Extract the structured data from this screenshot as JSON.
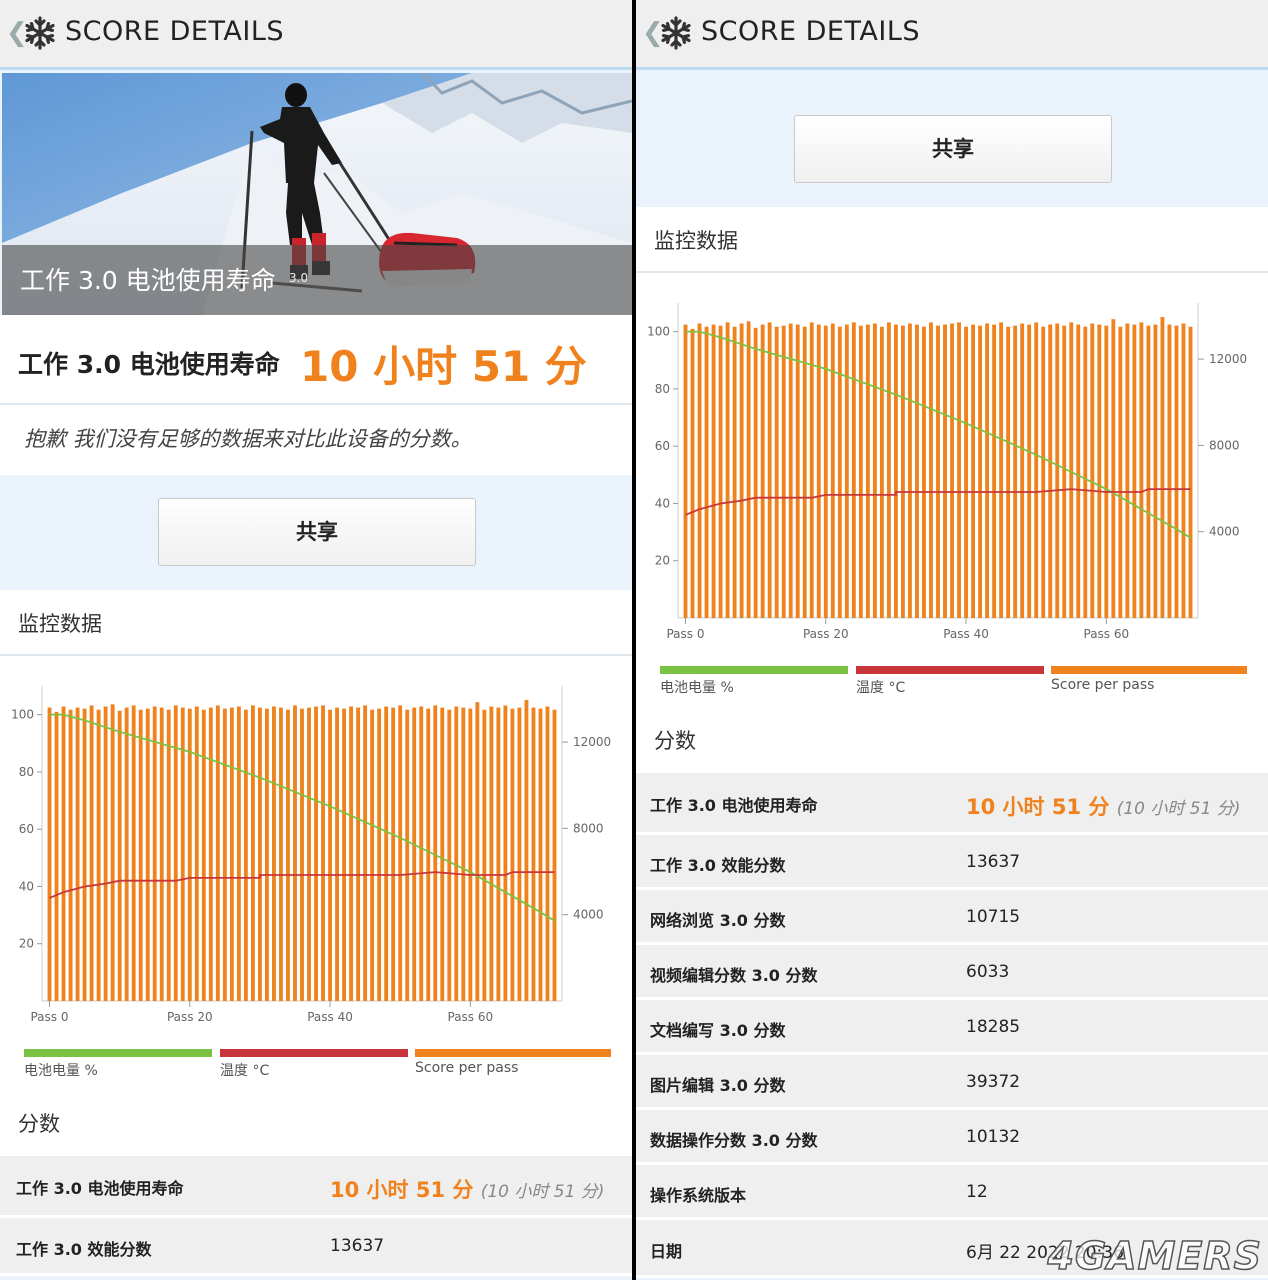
{
  "app": {
    "title": "SCORE DETAILS",
    "back_glyph": "❮",
    "logo_icon": "snowflake-icon"
  },
  "hero": {
    "caption": "工作 3.0 电池使用寿命",
    "version": "3.0"
  },
  "summary": {
    "test_name": "工作 3.0 电池使用寿命",
    "result": "10 小时 51 分",
    "sorry_text": "抱歉 我们没有足够的数据来对比此设备的分数。"
  },
  "share_label": "共享",
  "monitor_title": "监控数据",
  "scores_title": "分数",
  "legend": [
    {
      "label": "电池电量 %",
      "color": "#7cc242"
    },
    {
      "label": "温度 °C",
      "color": "#c8363c"
    },
    {
      "label": "Score per pass",
      "color": "#f0821e"
    }
  ],
  "colors": {
    "accent": "#f0821e",
    "battery": "#7cc242",
    "temperature": "#c8363c",
    "bars": "#f0821e"
  },
  "chart_data": {
    "type": "bar",
    "x_tick_labels": [
      "Pass 0",
      "Pass 20",
      "Pass 40",
      "Pass 60"
    ],
    "x_ticks": [
      0,
      20,
      40,
      60
    ],
    "left_axis": {
      "ticks": [
        100,
        80,
        60,
        40,
        20
      ],
      "ylim": [
        0,
        110
      ]
    },
    "right_axis": {
      "ticks": [
        12000,
        8000,
        4000
      ],
      "ylim": [
        0,
        14600
      ]
    },
    "passes": 73,
    "series": [
      {
        "name": "Score per pass",
        "axis": "right",
        "kind": "bar",
        "values": [
          13600,
          13400,
          13650,
          13500,
          13600,
          13550,
          13700,
          13500,
          13650,
          13750,
          13450,
          13600,
          13700,
          13500,
          13550,
          13650,
          13600,
          13500,
          13700,
          13600,
          13550,
          13650,
          13500,
          13600,
          13700,
          13550,
          13600,
          13650,
          13500,
          13700,
          13600,
          13550,
          13650,
          13600,
          13500,
          13700,
          13550,
          13600,
          13650,
          13700,
          13500,
          13600,
          13550,
          13650,
          13600,
          13700,
          13500,
          13550,
          13650,
          13600,
          13700,
          13500,
          13600,
          13650,
          13550,
          13700,
          13600,
          13500,
          13650,
          13600,
          13550,
          13850,
          13500,
          13650,
          13600,
          13700,
          13550,
          13600,
          13950,
          13600,
          13550,
          13650,
          13500
        ]
      },
      {
        "name": "电池电量 %",
        "axis": "left",
        "kind": "line",
        "points": [
          [
            0,
            100
          ],
          [
            2,
            100
          ],
          [
            5,
            98
          ],
          [
            10,
            94
          ],
          [
            20,
            87
          ],
          [
            30,
            78
          ],
          [
            40,
            68
          ],
          [
            50,
            57
          ],
          [
            55,
            51
          ],
          [
            60,
            45
          ],
          [
            65,
            38
          ],
          [
            70,
            31
          ],
          [
            72,
            28
          ]
        ]
      },
      {
        "name": "温度 °C",
        "axis": "left",
        "kind": "line",
        "points": [
          [
            0,
            36
          ],
          [
            2,
            38
          ],
          [
            5,
            40
          ],
          [
            8,
            41
          ],
          [
            10,
            42
          ],
          [
            18,
            42
          ],
          [
            20,
            43
          ],
          [
            30,
            43
          ],
          [
            30,
            44
          ],
          [
            40,
            44
          ],
          [
            50,
            44
          ],
          [
            55,
            45
          ],
          [
            60,
            44
          ],
          [
            65,
            44
          ],
          [
            66,
            45
          ],
          [
            72,
            45
          ]
        ]
      }
    ]
  },
  "scores": [
    {
      "key": "工作 3.0 电池使用寿命",
      "value": "10 小时 51 分",
      "sub": "(10 小时 51 分)",
      "highlight": true
    },
    {
      "key": "工作 3.0 效能分数",
      "value": "13637"
    },
    {
      "key": "网络浏览 3.0 分数",
      "value": "10715"
    },
    {
      "key": "视频编辑分数 3.0 分数",
      "value": "6033"
    },
    {
      "key": "文档编写 3.0 分数",
      "value": "18285"
    },
    {
      "key": "图片编辑 3.0 分数",
      "value": "39372"
    },
    {
      "key": "数据操作分数 3.0 分数",
      "value": "10132"
    },
    {
      "key": "操作系统版本",
      "value": "12"
    },
    {
      "key": "日期",
      "value": "6月 22 2022 20:36"
    }
  ],
  "watermark": "4GAMERS"
}
